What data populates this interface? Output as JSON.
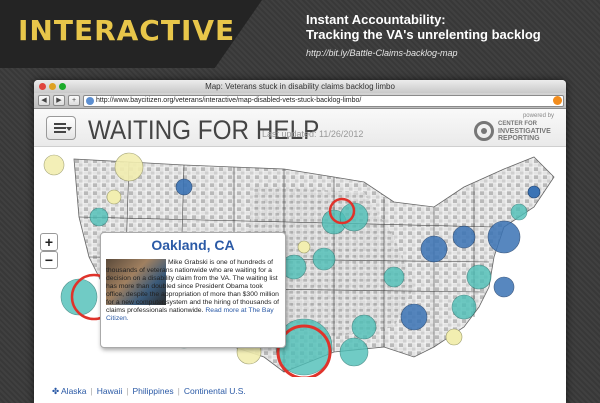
{
  "banner": {
    "title": "INTERACTIVE",
    "headline_line1": "Instant Accountability:",
    "headline_line2": "Tracking the VA's unrelenting backlog",
    "link": "http://bit.ly/Battle-Claims-backlog-map"
  },
  "browser": {
    "window_title": "Map: Veterans stuck in disability claims backlog limbo",
    "url": "http://www.baycitizen.org/veterans/interactive/map-disabled-vets-stuck-backlog-limbo/"
  },
  "page": {
    "title": "WAITING FOR HELP",
    "last_updated": "Last updated: 11/26/2012",
    "powered_by": "powered by",
    "cir_line1": "CENTER FOR",
    "cir_line2": "INVESTIGATIVE",
    "cir_line3": "REPORTING"
  },
  "map": {
    "zoom_in": "+",
    "zoom_out": "−",
    "popup": {
      "city": "Oakland, CA",
      "body": "Mike Grabski is one of hundreds of thousands of veterans nationwide who are waiting for a decision on a disability claim from the VA. The waiting list has more than doubled since President Obama took office, despite the appropriation of more than $300 million for a new computer system and the hiring of thousands of claims professionals nationwide.",
      "read_more": "Read more at The Bay Citizen."
    },
    "links": [
      "Alaska",
      "Hawaii",
      "Philippines",
      "Continental U.S."
    ]
  },
  "colors": {
    "banner_title": "#e8c64a",
    "bubble_light": "#f2eeb0",
    "bubble_teal": "#4dbfb7",
    "bubble_blue": "#3a73b5",
    "highlight_ring": "#e0332b",
    "link": "#2b5aa6"
  }
}
